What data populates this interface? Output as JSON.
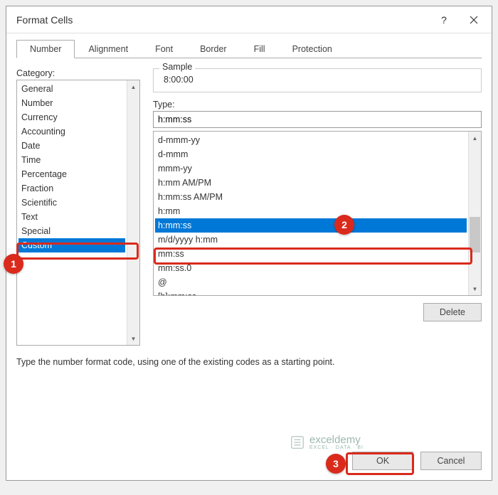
{
  "window": {
    "title": "Format Cells",
    "help": "?",
    "close": "×"
  },
  "tabs": [
    "Number",
    "Alignment",
    "Font",
    "Border",
    "Fill",
    "Protection"
  ],
  "activeTab": 0,
  "category": {
    "label": "Category:",
    "items": [
      "General",
      "Number",
      "Currency",
      "Accounting",
      "Date",
      "Time",
      "Percentage",
      "Fraction",
      "Scientific",
      "Text",
      "Special",
      "Custom"
    ],
    "selectedIndex": 11
  },
  "sample": {
    "legend": "Sample",
    "value": "8:00:00"
  },
  "type": {
    "label": "Type:",
    "input": "h:mm:ss",
    "items": [
      "d-mmm-yy",
      "d-mmm",
      "mmm-yy",
      "h:mm AM/PM",
      "h:mm:ss AM/PM",
      "h:mm",
      "h:mm:ss",
      "m/d/yyyy h:mm",
      "mm:ss",
      "mm:ss.0",
      "@",
      "[h]:mm:ss"
    ],
    "selectedIndex": 6
  },
  "buttons": {
    "delete": "Delete",
    "ok": "OK",
    "cancel": "Cancel"
  },
  "hint": "Type the number format code, using one of the existing codes as a starting point.",
  "callouts": [
    "1",
    "2",
    "3"
  ],
  "watermark": {
    "brand": "exceldemy",
    "tag": "EXCEL · DATA · BI"
  }
}
